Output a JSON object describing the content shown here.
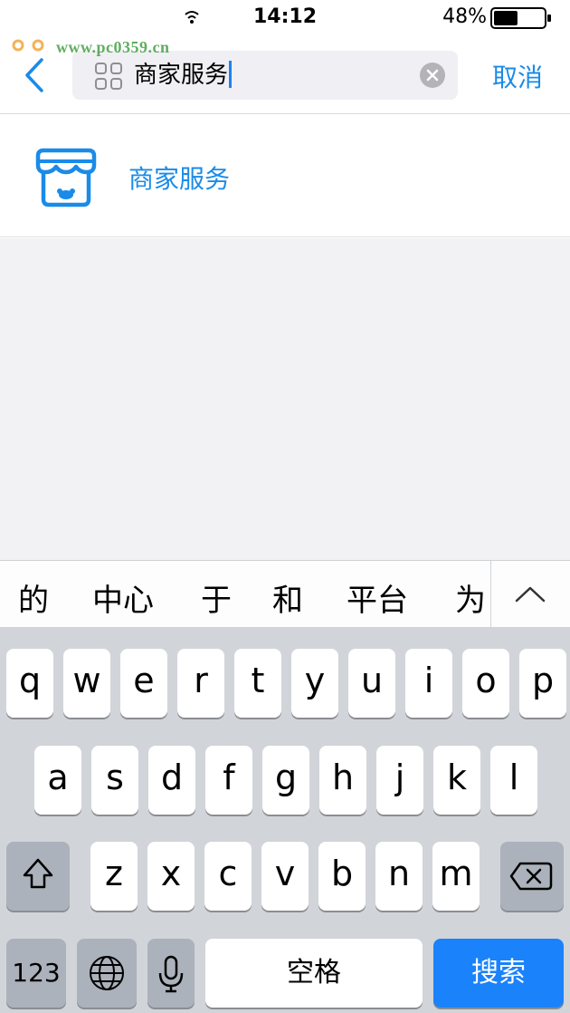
{
  "status_bar": {
    "time": "14:12",
    "battery_percent": "48%",
    "battery_level": 0.48
  },
  "watermark": {
    "text": "www.pc0359.cn"
  },
  "search": {
    "query": "商家服务",
    "cancel_label": "取消"
  },
  "results": [
    {
      "label": "商家服务",
      "icon": "merchant-store-icon"
    }
  ],
  "suggestions": [
    "的",
    "中心",
    "于",
    "和",
    "平台",
    "为"
  ],
  "keyboard": {
    "row1": [
      "q",
      "w",
      "e",
      "r",
      "t",
      "y",
      "u",
      "i",
      "o",
      "p"
    ],
    "row2": [
      "a",
      "s",
      "d",
      "f",
      "g",
      "h",
      "j",
      "k",
      "l"
    ],
    "row3": [
      "z",
      "x",
      "c",
      "v",
      "b",
      "n",
      "m"
    ],
    "numbers_label": "123",
    "space_label": "空格",
    "search_label": "搜索"
  },
  "colors": {
    "accent": "#1a8be8",
    "search_key": "#1a82fb",
    "keyboard_bg": "#d1d4d9"
  }
}
